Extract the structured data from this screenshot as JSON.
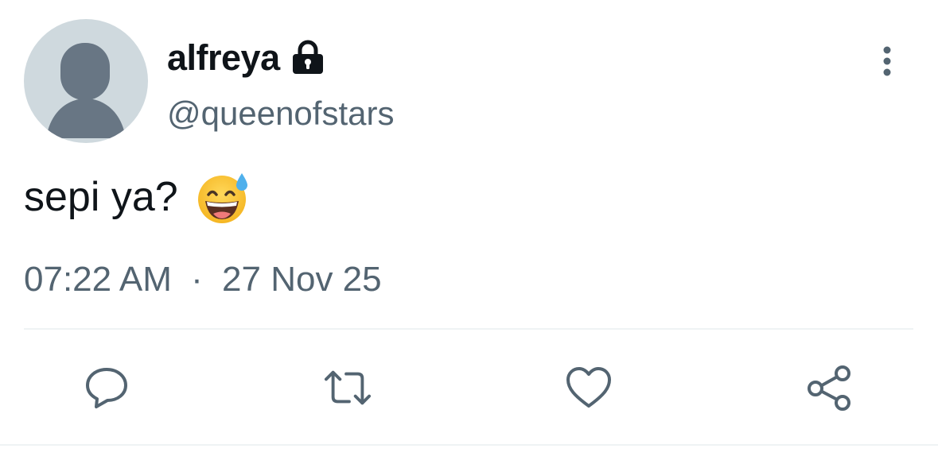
{
  "user": {
    "display_name": "alfreya",
    "handle": "@queenofstars",
    "protected": true
  },
  "tweet": {
    "text": "sepi ya?",
    "emoji": "grinning-face-with-sweat",
    "time": "07:22 AM",
    "separator": "·",
    "date": "27 Nov 25"
  },
  "actions": [
    "reply",
    "retweet",
    "like",
    "share"
  ],
  "colors": {
    "text_primary": "#0f1419",
    "text_secondary": "#536471",
    "divider": "#eff3f4",
    "avatar_bg": "#cfd9de",
    "avatar_fg": "#687684"
  }
}
